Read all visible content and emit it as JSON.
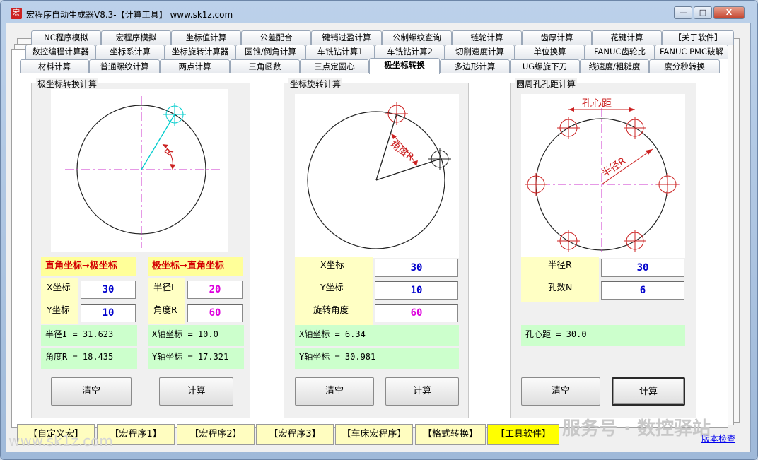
{
  "window": {
    "title": "宏程序自动生成器V8.3-【计算工具】    www.sk1z.com",
    "icon": "宏",
    "buttons": {
      "minimize": "—",
      "maximize": "□",
      "close": "X"
    }
  },
  "tabs": {
    "row1": [
      "NC程序模拟",
      "宏程序模拟",
      "坐标值计算",
      "公差配合",
      "键销过盈计算",
      "公制螺纹查询",
      "链轮计算",
      "齿厚计算",
      "花键计算",
      "【关于软件】"
    ],
    "row2": [
      "数控编程计算器",
      "坐标系计算",
      "坐标旋转计算器",
      "圆锥/倒角计算",
      "车铣钻计算1",
      "车铣钻计算2",
      "切削速度计算",
      "单位换算",
      "FANUC齿轮比",
      "FANUC PMC破解"
    ],
    "row3": [
      "材料计算",
      "普通螺纹计算",
      "两点计算",
      "三角函数",
      "三点定圆心",
      "极坐标转换",
      "多边形计算",
      "UG螺旋下刀",
      "线速度/粗糙度",
      "度分秒转换"
    ],
    "active": "极坐标转换"
  },
  "polar": {
    "title": "极坐标转换计算",
    "fig_label": "R",
    "left": {
      "header": "直角坐标→极坐标",
      "x_label": "X坐标",
      "x_value": "30",
      "y_label": "Y坐标",
      "y_value": "10",
      "result1": "半径I = 31.623",
      "result2": "角度R = 18.435"
    },
    "right": {
      "header": "极坐标→直角坐标",
      "r_label": "半径I",
      "r_value": "20",
      "a_label": "角度R",
      "a_value": "60",
      "result1": "X轴坐标 = 10.0",
      "result2": "Y轴坐标 = 17.321"
    },
    "clear": "清空",
    "calc": "计算"
  },
  "rotate": {
    "title": "坐标旋转计算",
    "fig_label": "角度R",
    "x_label": "X坐标",
    "x_value": "30",
    "y_label": "Y坐标",
    "y_value": "10",
    "ang_label": "旋转角度",
    "ang_value": "60",
    "result1": "X轴坐标 = 6.34",
    "result2": "Y轴坐标 = 30.981",
    "clear": "清空",
    "calc": "计算"
  },
  "holes": {
    "title": "圆周孔孔距计算",
    "fig_label1": "孔心距",
    "fig_label2": "半径R",
    "r_label": "半径R",
    "r_value": "30",
    "n_label": "孔数N",
    "n_value": "6",
    "result": "孔心距 = 30.0",
    "clear": "清空",
    "calc": "计算"
  },
  "bottom": [
    "【自定义宏】",
    "【宏程序1】",
    "【宏程序2】",
    "【宏程序3】",
    "【车床宏程序】",
    "【格式转换】",
    "【工具软件】"
  ],
  "bottom_selected": "【工具软件】",
  "watermark": "服务号 · 数控驿站",
  "watermark2": "www.sk1z.com",
  "version_link": "版本检查",
  "colors": {
    "header_bg": "#ffff99",
    "label_bg": "#ffffc4",
    "result_bg": "#ccffcc",
    "input_blue": "#0000cc",
    "input_magenta": "#dd00dd",
    "header_red": "#d40000"
  }
}
